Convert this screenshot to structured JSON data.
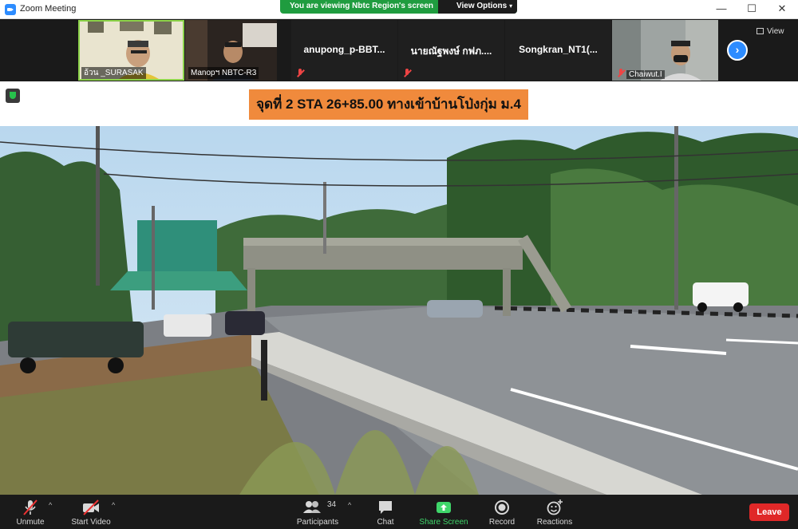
{
  "window": {
    "title": "Zoom Meeting",
    "minimize": "—",
    "maximize": "☐",
    "close": "✕"
  },
  "share_banner": {
    "text": "You are viewing Nbtc Region's screen",
    "view_options": "View Options"
  },
  "participants_strip": [
    {
      "name": "อ้วน _SURASAK",
      "video": true,
      "active": true
    },
    {
      "name": "Manopฯ NBTC-R3",
      "video": true,
      "active": false
    },
    {
      "name": "anupong_p-BBT...",
      "video": false,
      "muted": true
    },
    {
      "name": "นายณัฐพงษ์ กฟภ....",
      "video": false,
      "muted": true
    },
    {
      "name": "Songkran_NT1(...",
      "video": false,
      "muted": false
    },
    {
      "name": "Chaiwut.I",
      "video": true,
      "muted": true
    }
  ],
  "strip_controls": {
    "next": "›",
    "view": "View"
  },
  "shared_content": {
    "caption": "จุดที่ 2 STA 26+85.00   ทางเข้าบ้านโป่งกุ่ม ม.4"
  },
  "toolbar": {
    "unmute": "Unmute",
    "start_video": "Start Video",
    "participants": "Participants",
    "participants_count": "34",
    "chat": "Chat",
    "share_screen": "Share Screen",
    "record": "Record",
    "reactions": "Reactions",
    "leave": "Leave",
    "caret": "^"
  },
  "colors": {
    "share_green": "#1f9c3f",
    "accent_blue": "#2d8cff",
    "caption_orange": "#f08a3c",
    "leave_red": "#e02828"
  }
}
